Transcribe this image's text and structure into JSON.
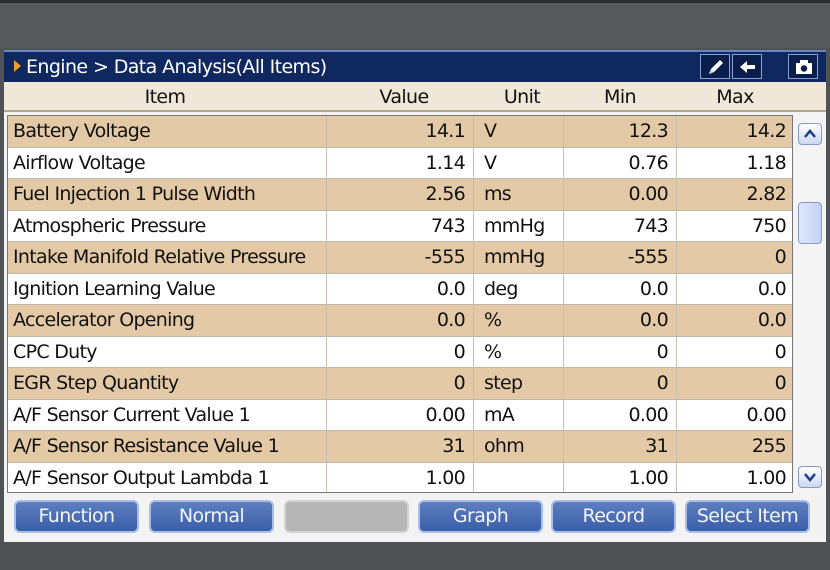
{
  "title": {
    "text": "Engine > Data Analysis(All Items)",
    "buttons": [
      {
        "icon": "pencil-icon"
      },
      {
        "icon": "back-arrow-icon"
      },
      {
        "icon": "camera-icon"
      }
    ]
  },
  "columns": [
    "Item",
    "Value",
    "Unit",
    "Min",
    "Max"
  ],
  "rows": [
    {
      "item": "Battery Voltage",
      "value": "14.1",
      "unit": "V",
      "min": "12.3",
      "max": "14.2"
    },
    {
      "item": "Airflow Voltage",
      "value": "1.14",
      "unit": "V",
      "min": "0.76",
      "max": "1.18"
    },
    {
      "item": "Fuel Injection 1 Pulse Width",
      "value": "2.56",
      "unit": "ms",
      "min": "0.00",
      "max": "2.82"
    },
    {
      "item": "Atmospheric Pressure",
      "value": "743",
      "unit": "mmHg",
      "min": "743",
      "max": "750"
    },
    {
      "item": "Intake Manifold Relative Pressure",
      "value": "-555",
      "unit": "mmHg",
      "min": "-555",
      "max": "0"
    },
    {
      "item": "Ignition Learning Value",
      "value": "0.0",
      "unit": "deg",
      "min": "0.0",
      "max": "0.0"
    },
    {
      "item": "Accelerator Opening",
      "value": "0.0",
      "unit": "%",
      "min": "0.0",
      "max": "0.0"
    },
    {
      "item": "CPC Duty",
      "value": "0",
      "unit": "%",
      "min": "0",
      "max": "0"
    },
    {
      "item": "EGR Step Quantity",
      "value": "0",
      "unit": "step",
      "min": "0",
      "max": "0"
    },
    {
      "item": "A/F Sensor Current Value 1",
      "value": "0.00",
      "unit": "mA",
      "min": "0.00",
      "max": "0.00"
    },
    {
      "item": "A/F Sensor Resistance Value 1",
      "value": "31",
      "unit": "ohm",
      "min": "31",
      "max": "255"
    },
    {
      "item": "A/F Sensor Output Lambda 1",
      "value": "1.00",
      "unit": "",
      "min": "1.00",
      "max": "1.00"
    }
  ],
  "function_buttons": [
    "Function",
    "Normal",
    "",
    "Graph",
    "Record",
    "Select Item"
  ],
  "colors": {
    "title_bar": "#102860",
    "row_alt": "#e3c9a6",
    "button": "#3f62aa",
    "accent_arrow": "#f0a020"
  }
}
